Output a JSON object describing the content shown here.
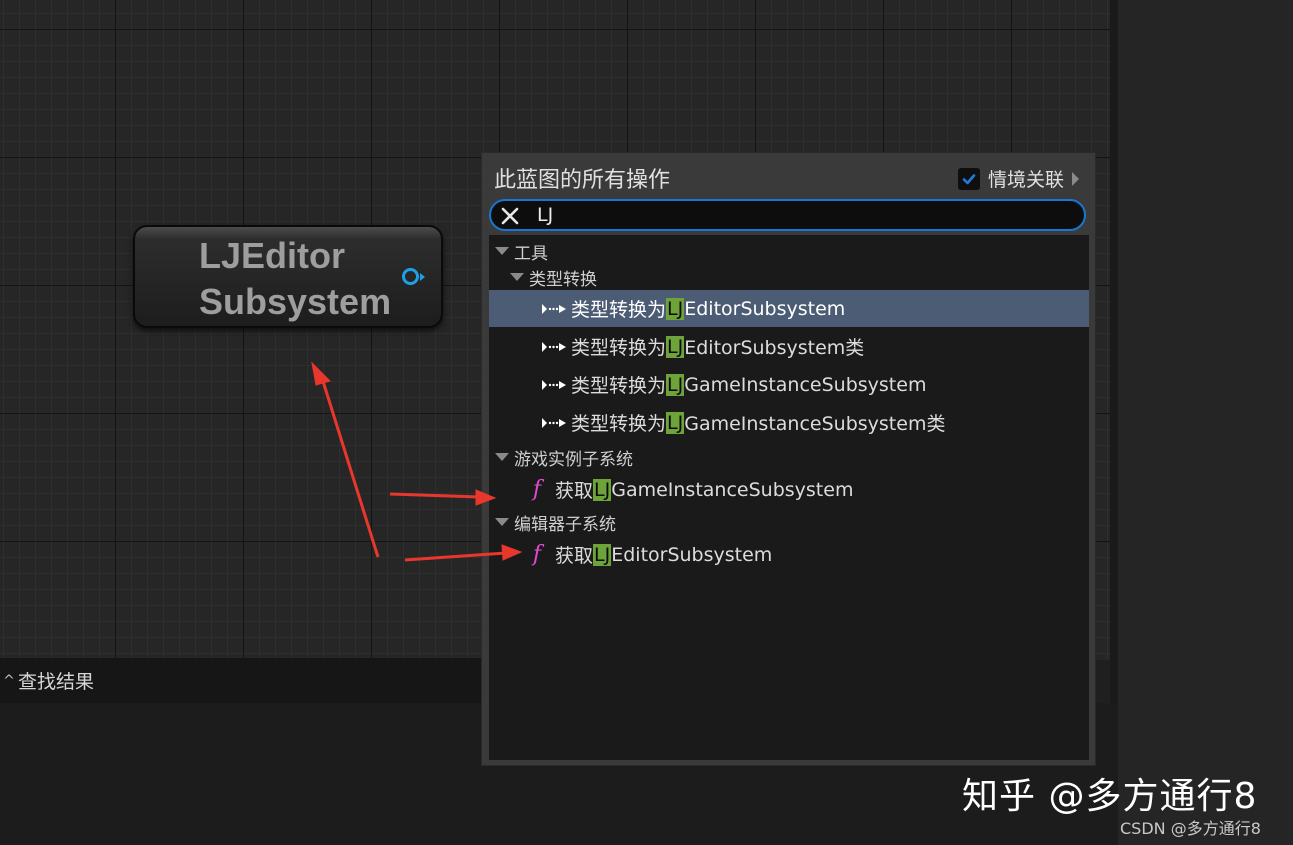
{
  "node": {
    "title_line1": "LJEditor",
    "title_line2": "Subsystem"
  },
  "action_menu": {
    "title": "此蓝图的所有操作",
    "context_sensitive_label": "情境关联",
    "context_sensitive_checked": true,
    "search": {
      "value": "LJ"
    },
    "categories": {
      "tools": "工具",
      "type_cast": "类型转换",
      "game_instance_subsystem": "游戏实例子系统",
      "editor_subsystem": "编辑器子系统"
    },
    "items": [
      {
        "prefix": "类型转换为 ",
        "match": "LJ",
        "rest": "EditorSubsystem",
        "selected": true
      },
      {
        "prefix": "类型转换为 ",
        "match": "LJ",
        "rest": "EditorSubsystem类",
        "selected": false
      },
      {
        "prefix": "类型转换为 ",
        "match": "LJ",
        "rest": "GameInstanceSubsystem",
        "selected": false
      },
      {
        "prefix": "类型转换为 ",
        "match": "LJ",
        "rest": "GameInstanceSubsystem类",
        "selected": false
      },
      {
        "prefix": "获取",
        "match": "LJ",
        "rest": "GameInstanceSubsystem",
        "selected": false
      },
      {
        "prefix": "获取",
        "match": "LJ",
        "rest": "EditorSubsystem",
        "selected": false
      }
    ]
  },
  "find_results": {
    "label": "查找结果"
  },
  "watermark": {
    "main": "知乎 @多方通行8",
    "sub": "CSDN @多方通行8"
  },
  "colors": {
    "search_border": "#1677d4",
    "match_highlight": "#6ea33a",
    "selected_row": "#4c5c74",
    "function_icon": "#e24ad0",
    "pin": "#1ea0e6",
    "annotation_arrow": "#e8372d"
  },
  "icons": {
    "clear": "close-icon",
    "cast": "cast-node-icon",
    "function": "function-icon",
    "checkbox": "checkmark-icon"
  }
}
